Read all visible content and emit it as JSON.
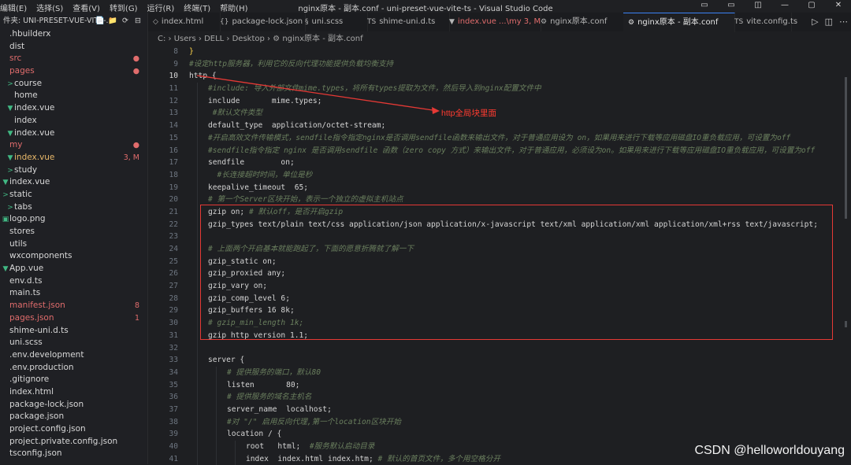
{
  "titlebar": {
    "menu": [
      "编辑(E)",
      "选择(S)",
      "查看(V)",
      "转到(G)",
      "运行(R)",
      "终端(T)",
      "帮助(H)"
    ],
    "window_title": "nginx原本 - 副本.conf - uni-preset-vue-vite-ts - Visual Studio Code",
    "controls": [
      "▭",
      "▭",
      "◫",
      "—",
      "▢",
      "✕"
    ]
  },
  "sidebar": {
    "header": "件夹: UNI-PRESET-VUE-VITE-...",
    "header_icons": [
      "📄",
      "📁",
      "⟳",
      "⊟"
    ],
    "items": [
      {
        "label": ".hbuilderx",
        "indent": 0,
        "icon": "",
        "badge": "",
        "state": ""
      },
      {
        "label": "dist",
        "indent": 0,
        "icon": "",
        "badge": "",
        "state": ""
      },
      {
        "label": "src",
        "indent": 0,
        "icon": "",
        "badge": "●",
        "state": "mod"
      },
      {
        "label": "pages",
        "indent": 0,
        "icon": "",
        "badge": "●",
        "state": "mod"
      },
      {
        "label": "course",
        "indent": 1,
        "icon": ">",
        "badge": "",
        "state": ""
      },
      {
        "label": "home",
        "indent": 1,
        "icon": "",
        "badge": "",
        "state": ""
      },
      {
        "label": "index.vue",
        "indent": 1,
        "icon": "▼",
        "badge": "",
        "state": ""
      },
      {
        "label": "index",
        "indent": 1,
        "icon": "",
        "badge": "",
        "state": ""
      },
      {
        "label": "index.vue",
        "indent": 1,
        "icon": "▼",
        "badge": "",
        "state": ""
      },
      {
        "label": "my",
        "indent": 0,
        "icon": "",
        "badge": "●",
        "state": "mod"
      },
      {
        "label": "index.vue",
        "indent": 1,
        "icon": "▼",
        "badge": "3, M",
        "state": "warn"
      },
      {
        "label": "study",
        "indent": 1,
        "icon": ">",
        "badge": "",
        "state": ""
      },
      {
        "label": "index.vue",
        "indent": 0,
        "icon": "▼",
        "badge": "",
        "state": ""
      },
      {
        "label": "static",
        "indent": 0,
        "icon": ">",
        "badge": "",
        "state": ""
      },
      {
        "label": "tabs",
        "indent": 1,
        "icon": ">",
        "badge": "",
        "state": ""
      },
      {
        "label": "logo.png",
        "indent": 0,
        "icon": "▣",
        "badge": "",
        "state": ""
      },
      {
        "label": "stores",
        "indent": 0,
        "icon": "",
        "badge": "",
        "state": ""
      },
      {
        "label": "utils",
        "indent": 0,
        "icon": "",
        "badge": "",
        "state": ""
      },
      {
        "label": "wxcomponents",
        "indent": 0,
        "icon": "",
        "badge": "",
        "state": ""
      },
      {
        "label": "App.vue",
        "indent": 0,
        "icon": "▼",
        "badge": "",
        "state": ""
      },
      {
        "label": "env.d.ts",
        "indent": 0,
        "icon": "",
        "badge": "",
        "state": ""
      },
      {
        "label": "main.ts",
        "indent": 0,
        "icon": "",
        "badge": "",
        "state": ""
      },
      {
        "label": "manifest.json",
        "indent": 0,
        "icon": "",
        "badge": "8",
        "state": "mod"
      },
      {
        "label": "pages.json",
        "indent": 0,
        "icon": "",
        "badge": "1",
        "state": "mod"
      },
      {
        "label": "shime-uni.d.ts",
        "indent": 0,
        "icon": "",
        "badge": "",
        "state": ""
      },
      {
        "label": "uni.scss",
        "indent": 0,
        "icon": "",
        "badge": "",
        "state": ""
      },
      {
        "label": ".env.development",
        "indent": 0,
        "icon": "",
        "badge": "",
        "state": ""
      },
      {
        "label": ".env.production",
        "indent": 0,
        "icon": "",
        "badge": "",
        "state": ""
      },
      {
        "label": ".gitignore",
        "indent": 0,
        "icon": "",
        "badge": "",
        "state": ""
      },
      {
        "label": "index.html",
        "indent": 0,
        "icon": "",
        "badge": "",
        "state": ""
      },
      {
        "label": "package-lock.json",
        "indent": 0,
        "icon": "",
        "badge": "",
        "state": ""
      },
      {
        "label": "package.json",
        "indent": 0,
        "icon": "",
        "badge": "",
        "state": ""
      },
      {
        "label": "project.config.json",
        "indent": 0,
        "icon": "",
        "badge": "",
        "state": ""
      },
      {
        "label": "project.private.config.json",
        "indent": 0,
        "icon": "",
        "badge": "",
        "state": ""
      },
      {
        "label": "tsconfig.json",
        "indent": 0,
        "icon": "",
        "badge": "",
        "state": ""
      }
    ]
  },
  "tabs": [
    {
      "label": "index.html",
      "icon": "◇",
      "state": ""
    },
    {
      "label": "package-lock.json",
      "icon": "{}",
      "state": ""
    },
    {
      "label": "uni.scss",
      "icon": "§",
      "state": ""
    },
    {
      "label": "shime-uni.d.ts",
      "icon": "TS",
      "state": ""
    },
    {
      "label": "index.vue ...\\my 3, M",
      "icon": "▼",
      "state": "warn"
    },
    {
      "label": "nginx原本.conf",
      "icon": "⚙",
      "state": ""
    },
    {
      "label": "nginx原本 - 副本.conf",
      "icon": "⚙",
      "state": "active"
    },
    {
      "label": "vite.config.ts",
      "icon": "TS",
      "state": ""
    }
  ],
  "editor_actions": [
    "▷",
    "◫",
    "⋯"
  ],
  "breadcrumb": "C: › Users › DELL › Desktop › ⚙ nginx原本 - 副本.conf",
  "editor": {
    "current_line": 10,
    "lines": [
      {
        "n": 8,
        "indent": 0,
        "text": "}",
        "type": "punc"
      },
      {
        "n": 9,
        "indent": 0,
        "text": "#设定http服务器，利用它的反向代理功能提供负载均衡支持",
        "type": "cm"
      },
      {
        "n": 10,
        "indent": 0,
        "text": "http {",
        "type": "code"
      },
      {
        "n": 11,
        "indent": 1,
        "text": "#include: 导入外部文件mime.types，将所有types提取为文件，然后导入到nginx配置文件中",
        "type": "cm"
      },
      {
        "n": 12,
        "indent": 1,
        "text": "include       mime.types;",
        "type": "code"
      },
      {
        "n": 13,
        "indent": 1,
        "text": " #默认文件类型",
        "type": "cm"
      },
      {
        "n": 14,
        "indent": 1,
        "text": "default_type  application/octet-stream;",
        "type": "code"
      },
      {
        "n": 15,
        "indent": 1,
        "text": "#开启高效文件传输模式，sendfile指令指定nginx是否调用sendfile函数来输出文件，对于普通应用设为 on，如果用来进行下载等应用磁盘IO重负载应用，可设置为off",
        "type": "cm"
      },
      {
        "n": 16,
        "indent": 1,
        "text": "#sendfile指令指定 nginx 是否调用sendfile 函数（zero copy 方式）来输出文件，对于普通应用，必须设为on。如果用来进行下载等应用磁盘IO重负载应用，可设置为off",
        "type": "cm"
      },
      {
        "n": 17,
        "indent": 1,
        "text": "sendfile        on;",
        "type": "code"
      },
      {
        "n": 18,
        "indent": 1,
        "text": "  #长连接超时时间，单位是秒",
        "type": "cm"
      },
      {
        "n": 19,
        "indent": 1,
        "text": "keepalive_timeout  65;",
        "type": "code"
      },
      {
        "n": 20,
        "indent": 1,
        "text": "# 第一个Server区块开始，表示一个独立的虚拟主机站点",
        "type": "cm"
      },
      {
        "n": 21,
        "indent": 1,
        "text": "gzip on; # 默认off，是否开启gzip",
        "type": "mixed",
        "code": "gzip on; ",
        "comment": "# 默认off，是否开启gzip"
      },
      {
        "n": 22,
        "indent": 1,
        "text": "gzip_types text/plain text/css application/json application/x-javascript text/xml application/xml application/xml+rss text/javascript;",
        "type": "code"
      },
      {
        "n": 23,
        "indent": 1,
        "text": "",
        "type": "code"
      },
      {
        "n": 24,
        "indent": 1,
        "text": "# 上面两个开启基本就能跑起了，下面的愿意折腾就了解一下",
        "type": "cm"
      },
      {
        "n": 25,
        "indent": 1,
        "text": "gzip_static on;",
        "type": "code"
      },
      {
        "n": 26,
        "indent": 1,
        "text": "gzip_proxied any;",
        "type": "code"
      },
      {
        "n": 27,
        "indent": 1,
        "text": "gzip_vary on;",
        "type": "code"
      },
      {
        "n": 28,
        "indent": 1,
        "text": "gzip_comp_level 6;",
        "type": "code"
      },
      {
        "n": 29,
        "indent": 1,
        "text": "gzip_buffers 16 8k;",
        "type": "code"
      },
      {
        "n": 30,
        "indent": 1,
        "text": "# gzip_min_length 1k;",
        "type": "cm"
      },
      {
        "n": 31,
        "indent": 1,
        "text": "gzip_http_version 1.1;",
        "type": "code"
      },
      {
        "n": 32,
        "indent": 1,
        "text": "",
        "type": "code"
      },
      {
        "n": 33,
        "indent": 1,
        "text": "server {",
        "type": "code"
      },
      {
        "n": 34,
        "indent": 2,
        "text": "# 提供服务的端口，默认80",
        "type": "cm"
      },
      {
        "n": 35,
        "indent": 2,
        "text": "listen       80;",
        "type": "code"
      },
      {
        "n": 36,
        "indent": 2,
        "text": "# 提供服务的域名主机名",
        "type": "cm"
      },
      {
        "n": 37,
        "indent": 2,
        "text": "server_name  localhost;",
        "type": "code"
      },
      {
        "n": 38,
        "indent": 2,
        "text": "#对 \"/\" 启用反向代理,第一个location区块开始",
        "type": "cm"
      },
      {
        "n": 39,
        "indent": 2,
        "text": "location / {",
        "type": "code"
      },
      {
        "n": 40,
        "indent": 3,
        "text": "root   html;  #服务默认启动目录",
        "type": "mixed",
        "code": "root   html;  ",
        "comment": "#服务默认启动目录"
      },
      {
        "n": 41,
        "indent": 3,
        "text": "index  index.html index.htm; # 默认的首页文件，多个用空格分开",
        "type": "mixed",
        "code": "index  index.html index.htm; ",
        "comment": "# 默认的首页文件，多个用空格分开"
      }
    ]
  },
  "annotation": "http全局块里面",
  "watermark": "CSDN @helloworldouyang"
}
